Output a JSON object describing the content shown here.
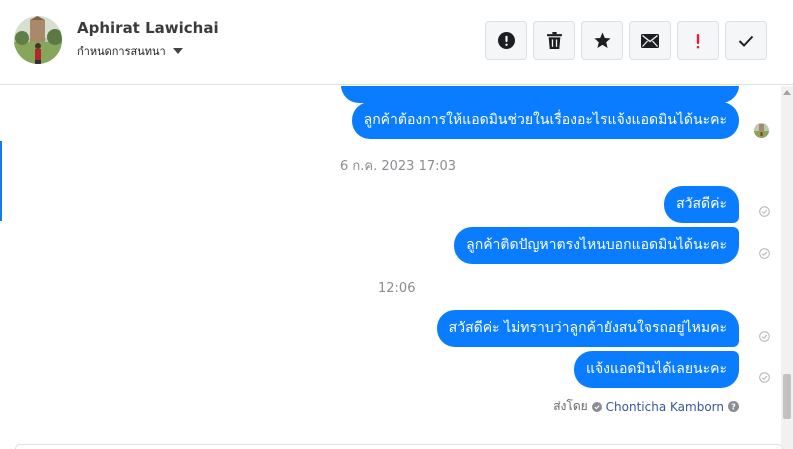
{
  "contact": {
    "name": "Aphirat Lawichai",
    "assign_label": "กำหนดการสนทนา"
  },
  "toolbar": {
    "actions": [
      {
        "icon": "alert-icon"
      },
      {
        "icon": "trash-icon"
      },
      {
        "icon": "star-icon"
      },
      {
        "icon": "envelope-icon"
      },
      {
        "icon": "exclamation-icon",
        "color": "#e41e3f"
      },
      {
        "icon": "check-icon"
      }
    ]
  },
  "messages": {
    "partial": "",
    "m1": "ลูกค้าต้องการให้แอดมินช่วยในเรื่องอะไรแจ้งแอดมินได้นะคะ",
    "ts1": "6 ก.ค. 2023 17:03",
    "m2": "สวัสดีค่ะ",
    "m3": "ลูกค้าติดปัญหาตรงไหนบอกแอดมินได้นะคะ",
    "ts2": "12:06",
    "m4": "สวัสดีค่ะ ไม่ทราบว่าลูกค้ายังสนใจรถอยู่ไหมคะ",
    "m5": "แจ้งแอดมินได้เลยนะคะ"
  },
  "sent_by": {
    "label": "ส่งโดย",
    "agent": "Chonticha Kamborn"
  },
  "colors": {
    "bubble": "#0a7cff",
    "accent": "#1877f2",
    "timestamp": "#8a8d91",
    "danger": "#e41e3f"
  }
}
